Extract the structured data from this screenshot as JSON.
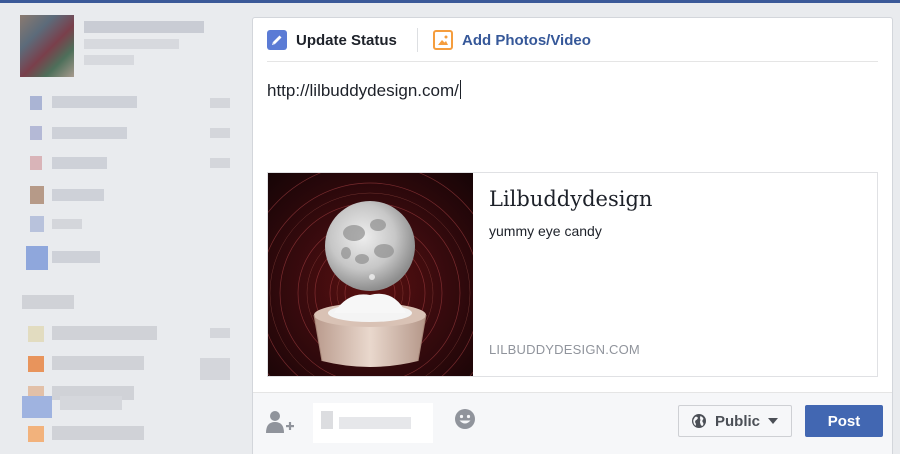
{
  "composer": {
    "tabs": [
      {
        "label": "Update Status",
        "icon": "pencil-icon",
        "active": true
      },
      {
        "label": "Add Photos/Video",
        "icon": "photo-icon",
        "active": false
      }
    ],
    "status_text": "http://lilbuddydesign.com/"
  },
  "link_preview": {
    "title": "Lilbuddydesign",
    "description": "yummy eye candy",
    "domain": "LILBUDDYDESIGN.COM",
    "image": "moon-over-bowl-thumbnail"
  },
  "footer": {
    "privacy_label": "Public",
    "post_label": "Post"
  },
  "colors": {
    "brand": "#3b5998",
    "post_button": "#4267b2",
    "link_tab": "#365899",
    "photo_icon_accent": "#f59d3d"
  }
}
